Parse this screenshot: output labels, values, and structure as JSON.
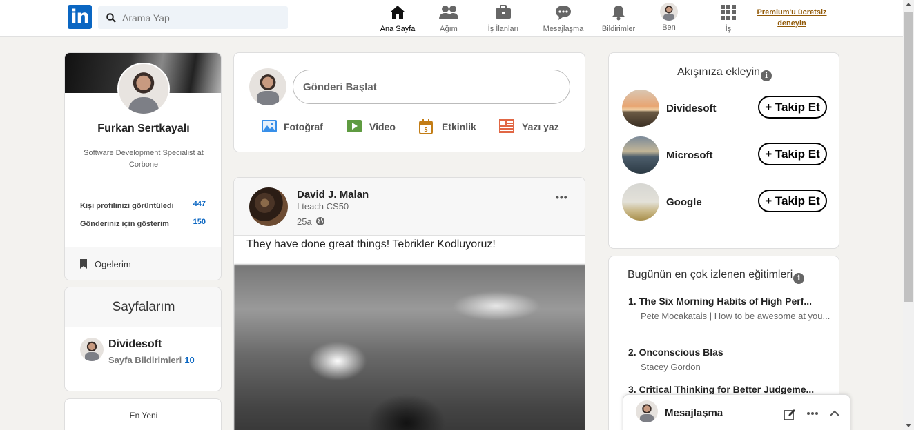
{
  "nav": {
    "logo_text": "in",
    "search_placeholder": "Arama Yap",
    "items": [
      {
        "label": "Ana Sayfa"
      },
      {
        "label": "Ağım"
      },
      {
        "label": "İş İlanları"
      },
      {
        "label": "Mesajlaşma"
      },
      {
        "label": "Bildirimler"
      },
      {
        "label": "Ben"
      },
      {
        "label": "İş"
      }
    ],
    "premium": "Premium'u ücretsiz deneyin"
  },
  "profile": {
    "name": "Furkan Sertkayalı",
    "headline": "Software Development Specialist at Corbone",
    "stats": [
      {
        "label": "Kişi profilinizi görüntüledi",
        "value": "447"
      },
      {
        "label": "Gönderiniz için gösterim",
        "value": "150"
      }
    ],
    "saved": "Ögelerim"
  },
  "pages": {
    "title": "Sayfalarım",
    "page_name": "Dividesoft",
    "notif_label": "Sayfa Bildirimleri",
    "notif_count": "10"
  },
  "newest": "En Yeni",
  "share": {
    "placeholder": "Gönderi Başlat",
    "actions": [
      {
        "label": "Fotoğraf"
      },
      {
        "label": "Video"
      },
      {
        "label": "Etkinlik"
      },
      {
        "label": "Yazı yaz"
      }
    ]
  },
  "post": {
    "author": "David J. Malan",
    "subtitle": "I teach CS50",
    "time": "25a",
    "more": "•••",
    "text": "They have done great things! Tebrikler Kodluyoruz!"
  },
  "follow": {
    "title": "Akışınıza ekleyin",
    "button_label": "+ Takip Et",
    "companies": [
      {
        "name": "Dividesoft"
      },
      {
        "name": "Microsoft"
      },
      {
        "name": "Google"
      }
    ]
  },
  "courses": {
    "title": "Bugünün en çok izlenen eğitimleri",
    "items": [
      {
        "title": "1. The Six Morning Habits of High Perf...",
        "sub": "Pete Mocakatais | How to be awesome at you..."
      },
      {
        "title": "2. Onconscious Blas",
        "sub": "Stacey Gordon"
      },
      {
        "title": "3. Critical Thinking for Better Judgeme...",
        "sub": ""
      }
    ]
  },
  "messaging": {
    "title": "Mesajlaşma"
  },
  "colors": {
    "brand": "#0a66c2",
    "premium": "#915907",
    "page_bg": "#f3f2ef"
  }
}
